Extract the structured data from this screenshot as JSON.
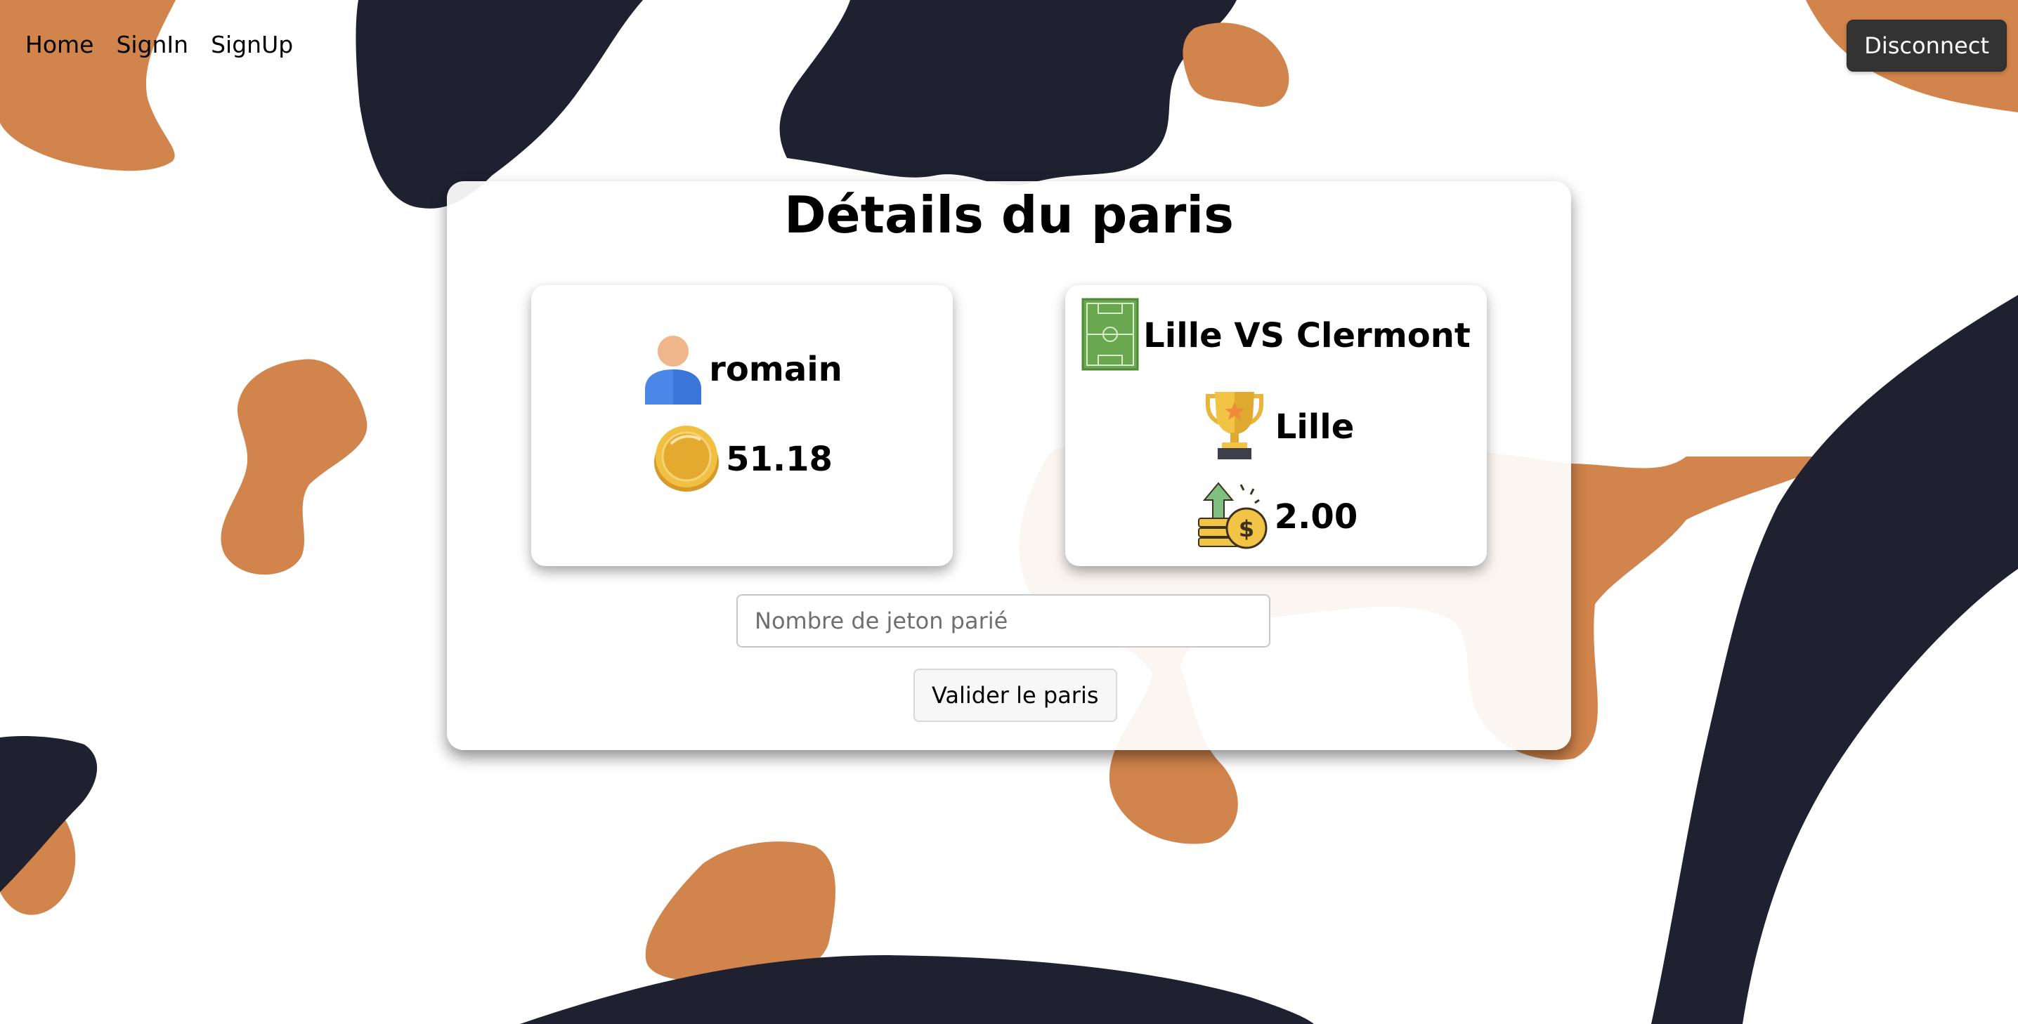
{
  "nav": {
    "links": [
      "Home",
      "SignIn",
      "SignUp"
    ],
    "disconnect_label": "Disconnect"
  },
  "page_title": "Détails du paris",
  "user_card": {
    "username": "romain",
    "balance": "51.18",
    "icons": [
      "user-avatar-icon",
      "gold-coin-icon"
    ]
  },
  "match_card": {
    "match": "Lille VS Clermont",
    "chosen_winner": "Lille",
    "odds": "2.00",
    "icons": [
      "football-field-icon",
      "trophy-icon",
      "money-growth-icon"
    ]
  },
  "bet_form": {
    "placeholder": "Nombre de jeton parié",
    "submit_label": "Valider le paris"
  },
  "colors": {
    "blob_orange": "#d1844b",
    "blob_navy": "#1f2130",
    "disconnect_bg": "#333333"
  }
}
